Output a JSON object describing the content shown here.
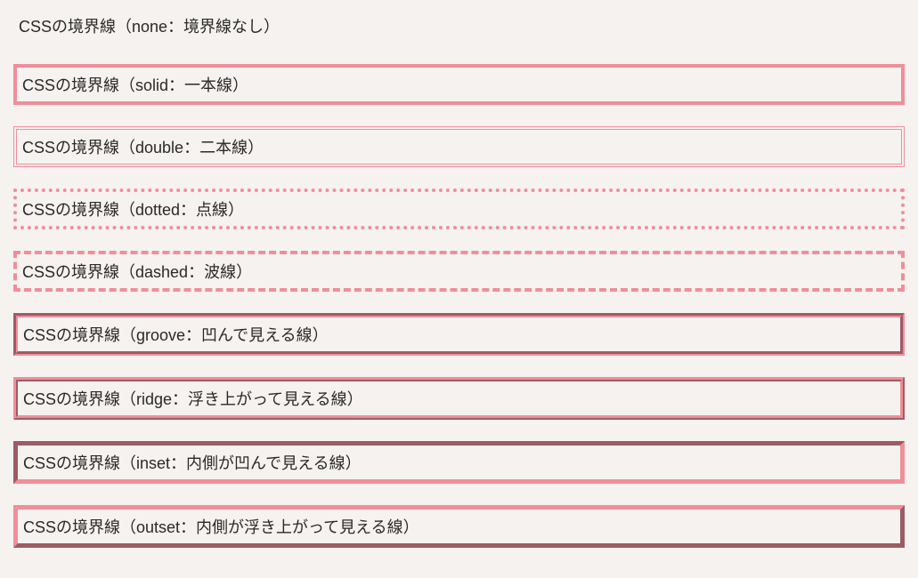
{
  "samples": [
    {
      "label": "CSSの境界線（none：境界線なし）"
    },
    {
      "label": "CSSの境界線（solid：一本線）"
    },
    {
      "label": "CSSの境界線（double：二本線）"
    },
    {
      "label": "CSSの境界線（dotted：点線）"
    },
    {
      "label": "CSSの境界線（dashed：波線）"
    },
    {
      "label": "CSSの境界線（groove：凹んで見える線）"
    },
    {
      "label": "CSSの境界線（ridge：浮き上がって見える線）"
    },
    {
      "label": "CSSの境界線（inset：内側が凹んで見える線）"
    },
    {
      "label": "CSSの境界線（outset：内側が浮き上がって見える線）"
    }
  ],
  "border_color": "#f08e9a"
}
